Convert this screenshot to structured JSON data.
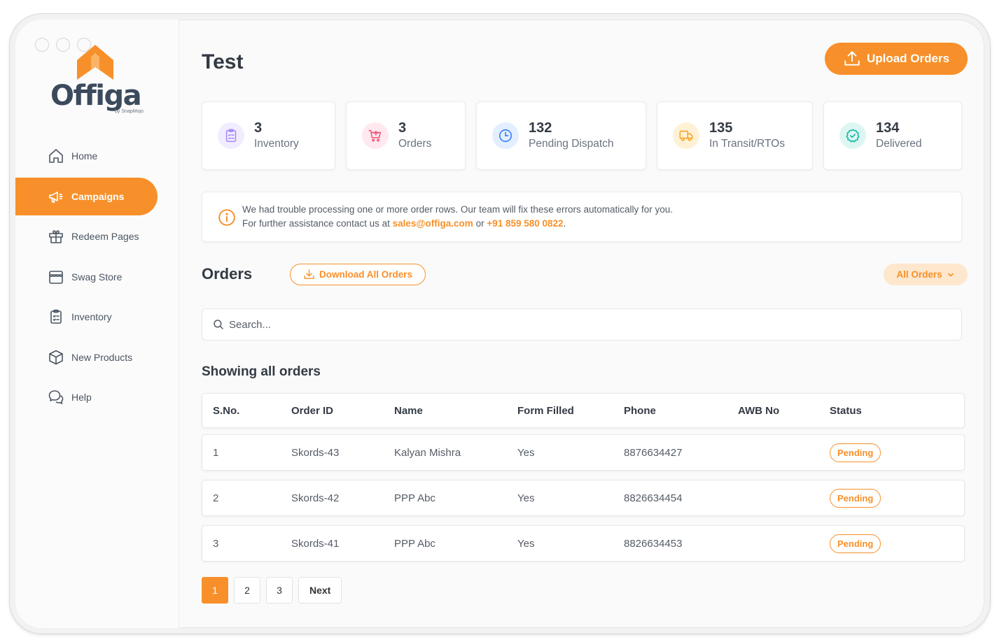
{
  "brand": {
    "name": "Offiga",
    "sub": "by SnapMojo",
    "accent": "#f7902a"
  },
  "sidebar": {
    "items": [
      {
        "label": "Home",
        "icon": "home-icon"
      },
      {
        "label": "Campaigns",
        "icon": "megaphone-icon",
        "active": true
      },
      {
        "label": "Redeem Pages",
        "icon": "gift-icon"
      },
      {
        "label": "Swag Store",
        "icon": "store-icon"
      },
      {
        "label": "Inventory",
        "icon": "clipboard-icon"
      },
      {
        "label": "New Products",
        "icon": "box-icon"
      },
      {
        "label": "Help",
        "icon": "chat-help-icon"
      }
    ]
  },
  "header": {
    "title": "Test",
    "upload_label": "Upload Orders"
  },
  "stats": [
    {
      "value": "3",
      "label": "Inventory",
      "icon": "clipboard-icon",
      "color": "#a78bfa"
    },
    {
      "value": "3",
      "label": "Orders",
      "icon": "cart-icon",
      "color": "#f0567a"
    },
    {
      "value": "132",
      "label": "Pending Dispatch",
      "icon": "clock-icon",
      "color": "#3b82f6"
    },
    {
      "value": "135",
      "label": "In Transit/RTOs",
      "icon": "truck-icon",
      "color": "#f5a524"
    },
    {
      "value": "134",
      "label": "Delivered",
      "icon": "check-circle-icon",
      "color": "#14b8a6"
    }
  ],
  "alert": {
    "line1": "We had trouble processing one or more order rows. Our team will fix these errors automatically for you.",
    "line2_prefix": "For further assistance contact us at ",
    "email": "sales@offiga.com",
    "line2_mid": " or ",
    "phone": "+91 859 580 0822",
    "line2_suffix": "."
  },
  "orders": {
    "title": "Orders",
    "download_label": "Download All Orders",
    "filter_label": "All Orders",
    "search_placeholder": "Search...",
    "showing_label": "Showing all orders",
    "columns": [
      "S.No.",
      "Order ID",
      "Name",
      "Form Filled",
      "Phone",
      "AWB No",
      "Status"
    ],
    "rows": [
      {
        "sno": "1",
        "order_id": "Skords-43",
        "name": "Kalyan Mishra",
        "form_filled": "Yes",
        "phone": "8876634427",
        "awb": "",
        "status": "Pending"
      },
      {
        "sno": "2",
        "order_id": "Skords-42",
        "name": "PPP Abc",
        "form_filled": "Yes",
        "phone": "8826634454",
        "awb": "",
        "status": "Pending"
      },
      {
        "sno": "3",
        "order_id": "Skords-41",
        "name": "PPP Abc",
        "form_filled": "Yes",
        "phone": "8826634453",
        "awb": "",
        "status": "Pending"
      }
    ]
  },
  "pagination": {
    "pages": [
      "1",
      "2",
      "3"
    ],
    "current": "1",
    "next_label": "Next"
  }
}
